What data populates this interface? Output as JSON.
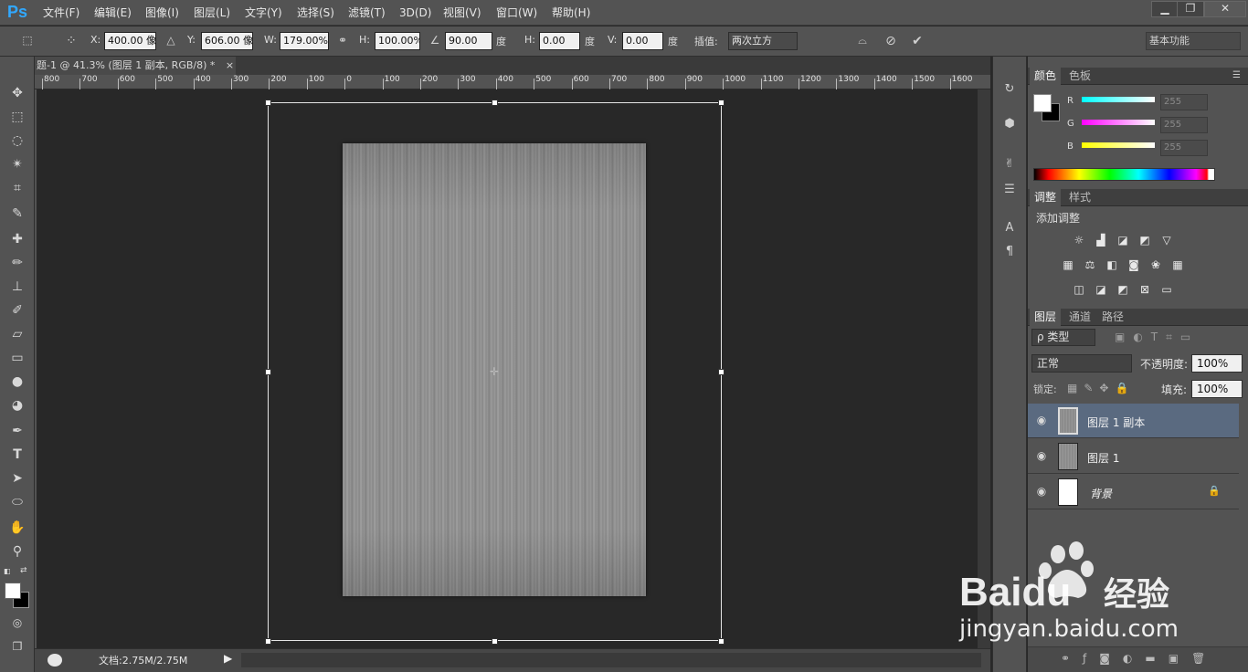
{
  "app": {
    "logo": "Ps"
  },
  "menu": [
    "文件(F)",
    "编辑(E)",
    "图像(I)",
    "图层(L)",
    "文字(Y)",
    "选择(S)",
    "滤镜(T)",
    "3D(D)",
    "视图(V)",
    "窗口(W)",
    "帮助(H)"
  ],
  "window_controls": {
    "minimize": "▁",
    "restore": "❐",
    "close": "✕"
  },
  "options": {
    "x_label": "X:",
    "x_value": "400.00 像",
    "y_label": "Y:",
    "y_value": "606.00 像",
    "w_label": "W:",
    "w_value": "179.00%",
    "h_label": "H:",
    "h_value": "100.00%",
    "angle_value": "90.00",
    "angle_unit": "度",
    "hskew_label": "H:",
    "hskew_value": "0.00",
    "hskew_unit": "度",
    "vskew_label": "V:",
    "vskew_value": "0.00",
    "vskew_unit": "度",
    "interp_label": "插值:",
    "interp_value": "两次立方",
    "workspace": "基本功能"
  },
  "document": {
    "tab_title": "题-1 @ 41.3% (图层 1 副本, RGB/8) *",
    "close": "×",
    "status": "文档:2.75M/2.75M"
  },
  "ruler": [
    "800",
    "700",
    "600",
    "500",
    "400",
    "300",
    "200",
    "100",
    "0",
    "100",
    "200",
    "300",
    "400",
    "500",
    "600",
    "700",
    "800",
    "900",
    "1000",
    "1100",
    "1200",
    "1300",
    "1400",
    "1500",
    "1600"
  ],
  "color_panel": {
    "tabs": [
      "颜色",
      "色板"
    ],
    "r_label": "R",
    "g_label": "G",
    "b_label": "B",
    "r": "255",
    "g": "255",
    "b": "255",
    "colors": {
      "fg": "#ffffff",
      "bg": "#000000"
    }
  },
  "adjust_panel": {
    "tabs": [
      "调整",
      "样式"
    ],
    "title": "添加调整"
  },
  "layers_panel": {
    "tabs": [
      "图层",
      "通道",
      "路径"
    ],
    "filter": "ρ 类型",
    "blend": "正常",
    "opacity_label": "不透明度:",
    "opacity": "100%",
    "lock_label": "锁定:",
    "fill_label": "填充:",
    "fill": "100%",
    "layers": [
      {
        "name": "图层 1 副本",
        "selected": true
      },
      {
        "name": "图层 1",
        "selected": false
      },
      {
        "name": "背景",
        "selected": false,
        "locked": true
      }
    ]
  },
  "watermark": {
    "brand": "Baidu",
    "brand_cn": "经验",
    "url": "jingyan.baidu.com"
  }
}
